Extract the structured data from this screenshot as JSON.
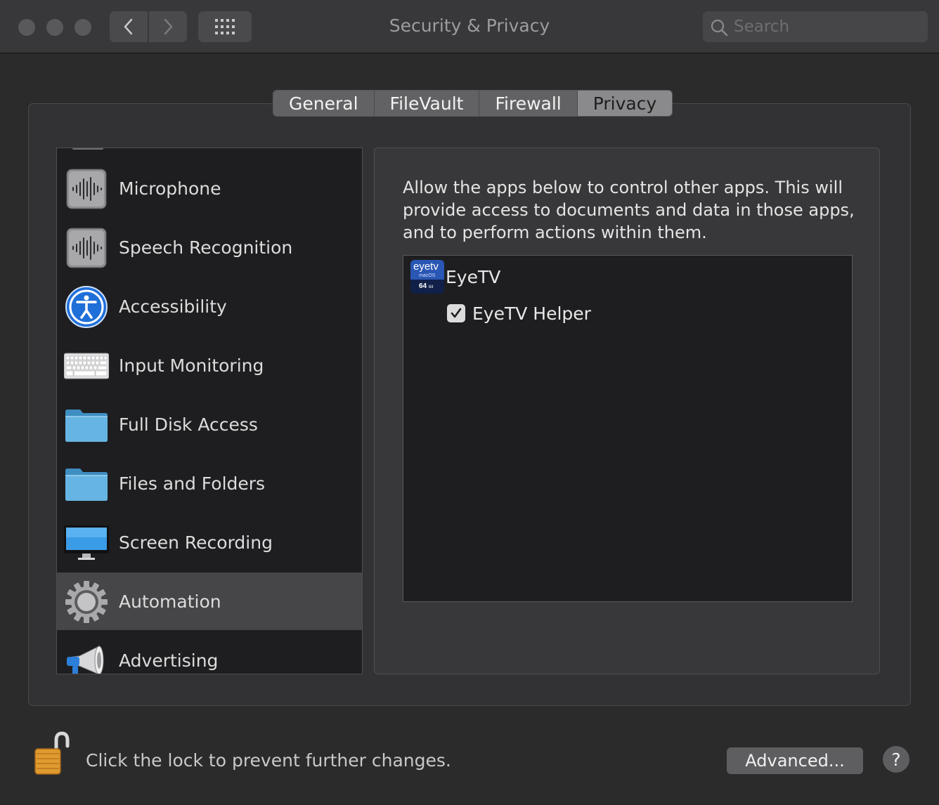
{
  "window": {
    "title": "Security & Privacy",
    "search_placeholder": "Search"
  },
  "tabs": [
    {
      "label": "General",
      "active": false
    },
    {
      "label": "FileVault",
      "active": false
    },
    {
      "label": "Firewall",
      "active": false
    },
    {
      "label": "Privacy",
      "active": true
    }
  ],
  "sidebar": {
    "items": [
      {
        "label": "Microphone",
        "icon": "microphone-waveform-icon"
      },
      {
        "label": "Speech Recognition",
        "icon": "speech-waveform-icon"
      },
      {
        "label": "Accessibility",
        "icon": "accessibility-icon"
      },
      {
        "label": "Input Monitoring",
        "icon": "keyboard-icon"
      },
      {
        "label": "Full Disk Access",
        "icon": "folder-icon"
      },
      {
        "label": "Files and Folders",
        "icon": "folder-icon"
      },
      {
        "label": "Screen Recording",
        "icon": "display-icon"
      },
      {
        "label": "Automation",
        "icon": "gear-icon",
        "selected": true
      },
      {
        "label": "Advertising",
        "icon": "megaphone-icon"
      }
    ]
  },
  "detail": {
    "description": "Allow the apps below to control other apps. This will provide access to documents and data in those apps, and to perform actions within them.",
    "app": {
      "name": "EyeTV",
      "icon_text": "eyetv",
      "icon_sub": "macOS",
      "icon_badge": "64",
      "icon_badge_unit": "bit"
    },
    "sub_app": {
      "name": "EyeTV Helper",
      "checked": true
    }
  },
  "footer": {
    "lock_text": "Click the lock to prevent further changes.",
    "advanced_label": "Advanced...",
    "help_label": "?"
  },
  "colors": {
    "background": "#2b2b2c",
    "titlebar": "#38383a",
    "list_bg": "#1e1e20",
    "selected_row": "#464648",
    "active_tab": "#8a8a8c"
  }
}
